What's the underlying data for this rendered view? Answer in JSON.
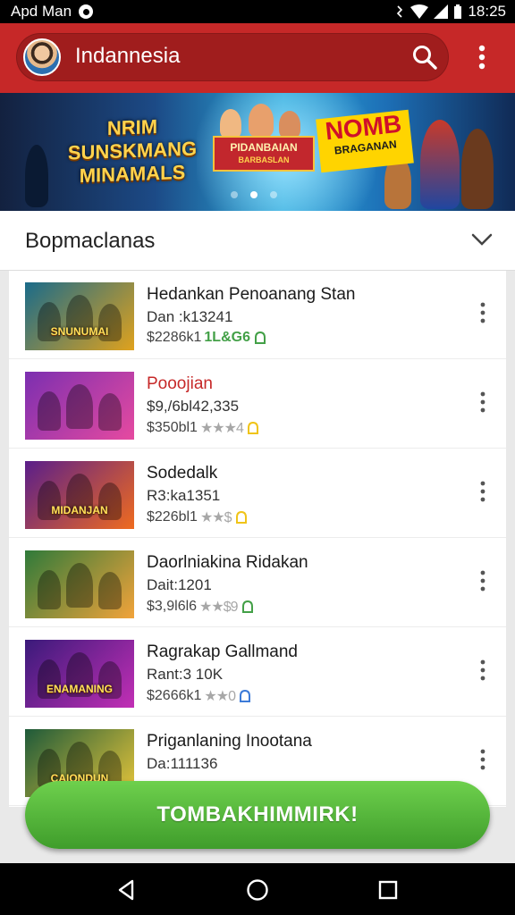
{
  "status_bar": {
    "carrier": "Apd Man",
    "time": "18:25"
  },
  "app_bar": {
    "title": "Indannesia"
  },
  "banner": {
    "left_title": "SUNSKMANG MINAMALS",
    "left_kicker": "NRIM",
    "middle_title": "PIDANBAIAN",
    "middle_sub": "BARBASLAN",
    "right_title": "NOMB",
    "right_sub": "BRAGANAN",
    "active_slide": 2,
    "slide_count": 3
  },
  "section": {
    "title": "Bopmaclanas"
  },
  "games": [
    {
      "title": "Hedankan Penoanang Stan",
      "sub": "Dan :k13241",
      "meta": "$2286k1",
      "rating_text": "1L&G6",
      "title_red": false,
      "thumb_caption": "SNUNUMAI",
      "thumb_colors": [
        "#1a6b8a",
        "#e0a21d"
      ],
      "tag_color": "#43a047"
    },
    {
      "title": "Pooojian",
      "sub": "$9,/6bl42,335",
      "meta": "$350bl1",
      "rating_text": "★★★4",
      "title_red": true,
      "thumb_caption": "",
      "thumb_colors": [
        "#7b2fb0",
        "#e64aa0"
      ],
      "tag_color": "#f0c419"
    },
    {
      "title": "Sodedalk",
      "sub": "R3:ka1351",
      "meta": "$226bl1",
      "rating_text": "★★$",
      "title_red": false,
      "thumb_caption": "MIDANJAN",
      "thumb_colors": [
        "#5a1e8a",
        "#ef6b1f"
      ],
      "tag_color": "#f0c419"
    },
    {
      "title": "Daorlniakina Ridakan",
      "sub": "Dait:1201",
      "meta": "$3,9l6l6",
      "rating_text": "★★$9",
      "title_red": false,
      "thumb_caption": "",
      "thumb_colors": [
        "#2f7a3a",
        "#f2a33a"
      ],
      "tag_color": "#43a047"
    },
    {
      "title": "Ragrakap Gallmand",
      "sub": "Rant:3 10K",
      "meta": "$2666k1",
      "rating_text": "★★0",
      "title_red": false,
      "thumb_caption": "ENAMANING",
      "thumb_colors": [
        "#3a1a7a",
        "#c22fb5"
      ],
      "tag_color": "#3d7bd8"
    },
    {
      "title": "Priganlaning Inootana",
      "sub": "Da:111136",
      "meta": "",
      "rating_text": "",
      "title_red": false,
      "thumb_caption": "CAIONDUN",
      "thumb_colors": [
        "#1e5a3a",
        "#e8c63a"
      ],
      "tag_color": "#43a047"
    }
  ],
  "cta": {
    "label": "TOMBAKHIMMIRK!"
  }
}
